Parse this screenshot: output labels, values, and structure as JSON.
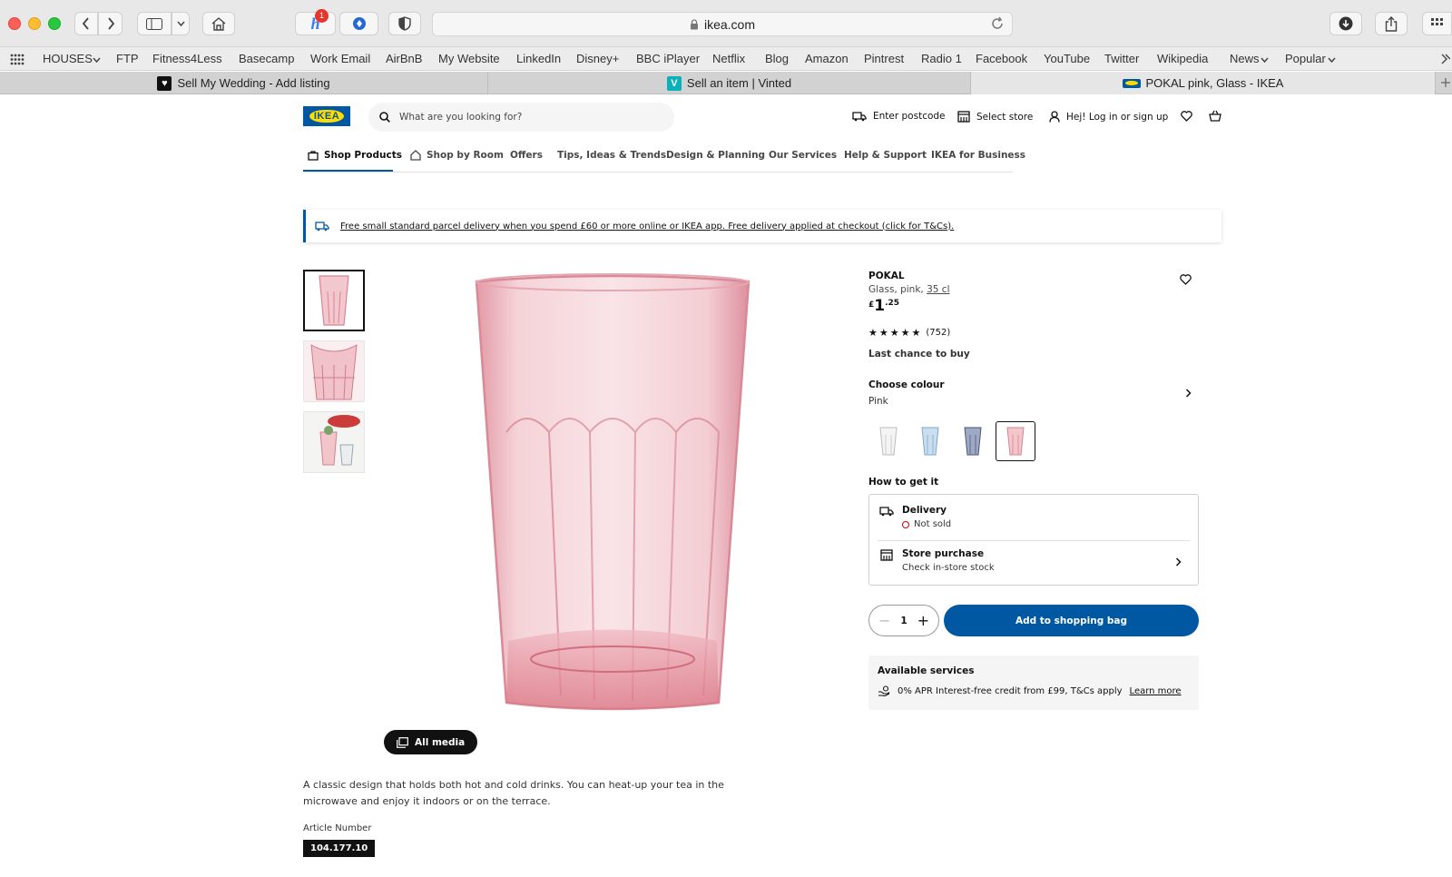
{
  "browser": {
    "url": "ikea.com",
    "extension_badge": "1",
    "bookmarks": [
      "HOUSES",
      "FTP",
      "Fitness4Less",
      "Basecamp",
      "Work Email",
      "AirBnB",
      "My Website",
      "LinkedIn",
      "Disney+",
      "BBC iPlayer",
      "Netflix",
      "Blog",
      "Amazon",
      "Pintrest",
      "Radio 1",
      "Facebook",
      "YouTube",
      "Twitter",
      "Wikipedia",
      "News",
      "Popular"
    ],
    "tabs": [
      {
        "title": "Sell My Wedding - Add listing",
        "active": false
      },
      {
        "title": "Sell an item | Vinted",
        "active": false
      },
      {
        "title": "POKAL pink, Glass - IKEA",
        "active": true
      }
    ]
  },
  "header": {
    "logo_text": "IKEA",
    "search_placeholder": "What are you looking for?",
    "postcode": "Enter postcode",
    "store": "Select store",
    "login": "Hej! Log in or sign up"
  },
  "nav": [
    "Shop Products",
    "Shop by Room",
    "Offers",
    "Tips, Ideas & Trends",
    "Design & Planning",
    "Our Services",
    "Help & Support",
    "IKEA for Business"
  ],
  "banner": "Free small standard parcel delivery when you spend £60 or more online or IKEA app. Free delivery applied at checkout (click for T&Cs).",
  "media": {
    "all_media": "All media"
  },
  "product": {
    "name": "POKAL",
    "desc_prefix": "Glass, pink, ",
    "size": "35 cl",
    "price_currency": "£",
    "price_int": "1",
    "price_dec": ".25",
    "rating": 5,
    "reviews": "(752)",
    "availability_note": "Last chance to buy",
    "choose_colour": "Choose colour",
    "colour": "Pink",
    "how_to_get": "How to get it",
    "delivery_title": "Delivery",
    "delivery_status": "Not sold",
    "store_title": "Store purchase",
    "store_sub": "Check in-store stock",
    "quantity": "1",
    "add_to_bag": "Add to shopping bag",
    "services_title": "Available services",
    "services_text": "0% APR Interest-free credit from £99, T&Cs apply",
    "learn_more": "Learn more",
    "description": "A classic design that holds both hot and cold drinks. You can heat-up your tea in the microwave and enjoy it indoors or on the terrace.",
    "article_label": "Article Number",
    "article_number": "104.177.10"
  },
  "colors": {
    "ikea_blue": "#0058a3",
    "ikea_yellow": "#ffdb00",
    "glass_pink": "#e9a0ab",
    "not_sold_red": "#cc0008"
  }
}
